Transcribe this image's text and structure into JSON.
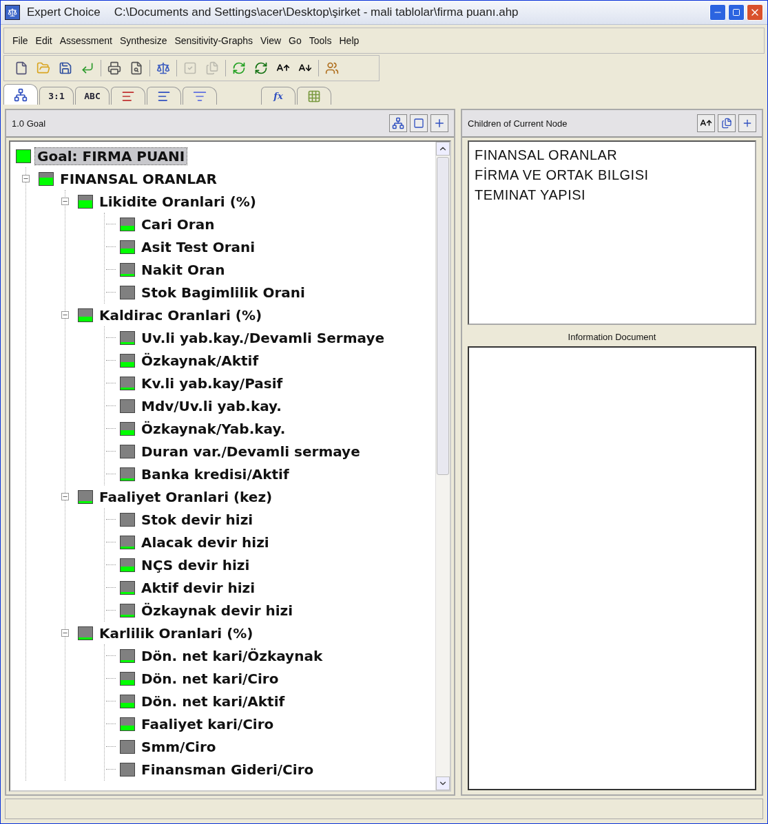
{
  "window": {
    "title": "Expert Choice",
    "path": "C:\\Documents and Settings\\acer\\Desktop\\şirket - mali tablolar\\firma puanı.ahp"
  },
  "menu": [
    "File",
    "Edit",
    "Assessment",
    "Synthesize",
    "Sensitivity-Graphs",
    "View",
    "Go",
    "Tools",
    "Help"
  ],
  "toolbar": [
    {
      "kind": "new",
      "disabled": false
    },
    {
      "kind": "open",
      "disabled": false
    },
    {
      "kind": "save",
      "disabled": false
    },
    {
      "kind": "enter",
      "disabled": false
    },
    {
      "kind": "sep"
    },
    {
      "kind": "print",
      "disabled": false
    },
    {
      "kind": "preview",
      "disabled": false
    },
    {
      "kind": "sep"
    },
    {
      "kind": "scale",
      "disabled": false
    },
    {
      "kind": "sep"
    },
    {
      "kind": "check",
      "disabled": true
    },
    {
      "kind": "pages",
      "disabled": true
    },
    {
      "kind": "sep"
    },
    {
      "kind": "refresh",
      "disabled": false
    },
    {
      "kind": "refresh-dot",
      "disabled": false
    },
    {
      "kind": "font-up",
      "disabled": false
    },
    {
      "kind": "font-down",
      "disabled": false
    },
    {
      "kind": "sep"
    },
    {
      "kind": "people",
      "disabled": false
    }
  ],
  "tabs": [
    {
      "kind": "tree",
      "selected": true
    },
    {
      "kind": "text",
      "label": "3:1",
      "selected": false
    },
    {
      "kind": "text",
      "label": "ABC",
      "selected": false
    },
    {
      "kind": "bars-red",
      "selected": false
    },
    {
      "kind": "bars",
      "selected": false
    },
    {
      "kind": "funnel",
      "selected": false
    },
    {
      "kind": "gap"
    },
    {
      "kind": "formula",
      "label": "fx",
      "selected": false
    },
    {
      "kind": "grid",
      "selected": false
    }
  ],
  "left_pane": {
    "header": "1.0 Goal",
    "tree": {
      "label": "Goal: FIRMA PUANI",
      "kind": "full",
      "selected": true,
      "children": [
        {
          "label": "FINANSAL ORANLAR",
          "kind": "high",
          "selected": false,
          "expanded": true,
          "children": [
            {
              "label": "Likidite Oranlari (%)",
              "kind": "high",
              "selected": false,
              "expanded": true,
              "children": [
                {
                  "label": "Cari Oran",
                  "kind": "mid",
                  "selected": false
                },
                {
                  "label": "Asit Test Orani",
                  "kind": "mid",
                  "selected": false
                },
                {
                  "label": "Nakit Oran",
                  "kind": "low",
                  "selected": false
                },
                {
                  "label": "Stok Bagimlilik Orani",
                  "kind": "none",
                  "selected": false
                }
              ]
            },
            {
              "label": "Kaldirac Oranlari (%)",
              "kind": "mid",
              "selected": false,
              "expanded": true,
              "children": [
                {
                  "label": "Uv.li yab.kay./Devamli Sermaye",
                  "kind": "low",
                  "selected": false
                },
                {
                  "label": "Özkaynak/Aktif",
                  "kind": "mid",
                  "selected": false
                },
                {
                  "label": "Kv.li yab.kay/Pasif",
                  "kind": "low",
                  "selected": false
                },
                {
                  "label": "Mdv/Uv.li yab.kay.",
                  "kind": "none",
                  "selected": false
                },
                {
                  "label": "Özkaynak/Yab.kay.",
                  "kind": "mid",
                  "selected": false
                },
                {
                  "label": "Duran var./Devamli sermaye",
                  "kind": "none",
                  "selected": false
                },
                {
                  "label": "Banka kredisi/Aktif",
                  "kind": "low",
                  "selected": false
                }
              ]
            },
            {
              "label": "Faaliyet Oranlari (kez)",
              "kind": "low",
              "selected": false,
              "expanded": true,
              "children": [
                {
                  "label": "Stok devir hizi",
                  "kind": "none",
                  "selected": false
                },
                {
                  "label": "Alacak devir hizi",
                  "kind": "low",
                  "selected": false
                },
                {
                  "label": "NÇS devir hizi",
                  "kind": "mid",
                  "selected": false
                },
                {
                  "label": "Aktif devir hizi",
                  "kind": "low",
                  "selected": false
                },
                {
                  "label": "Özkaynak devir hizi",
                  "kind": "low",
                  "selected": false
                }
              ]
            },
            {
              "label": "Karlilik Oranlari (%)",
              "kind": "low",
              "selected": false,
              "expanded": true,
              "children": [
                {
                  "label": "Dön. net kari/Özkaynak",
                  "kind": "low",
                  "selected": false
                },
                {
                  "label": "Dön. net kari/Ciro",
                  "kind": "mid",
                  "selected": false
                },
                {
                  "label": "Dön. net kari/Aktif",
                  "kind": "mid",
                  "selected": false
                },
                {
                  "label": "Faaliyet kari/Ciro",
                  "kind": "mid",
                  "selected": false
                },
                {
                  "label": "Smm/Ciro",
                  "kind": "none",
                  "selected": false
                },
                {
                  "label": "Finansman Gideri/Ciro",
                  "kind": "none",
                  "selected": false
                }
              ]
            }
          ]
        }
      ]
    }
  },
  "right_pane": {
    "header": "Children of Current Node",
    "children": [
      "FINANSAL ORANLAR",
      "FİRMA VE ORTAK BILGISI",
      "TEMINAT YAPISI"
    ],
    "info_label": "Information Document"
  }
}
